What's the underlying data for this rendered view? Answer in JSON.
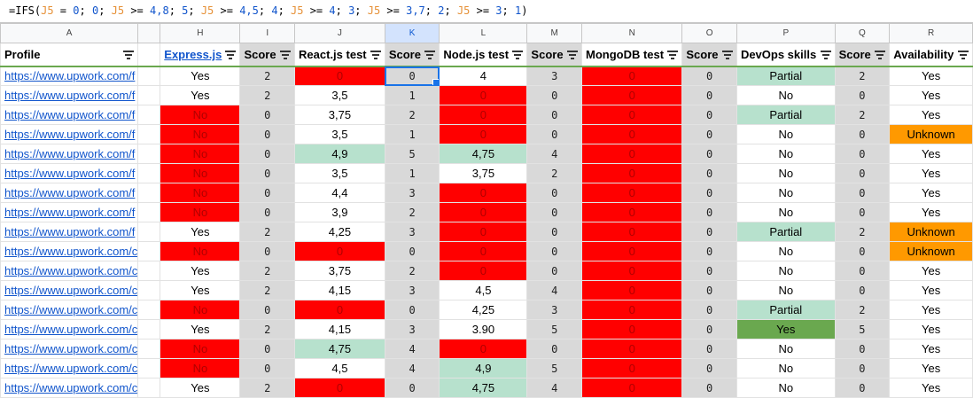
{
  "formula_bar": {
    "tokens": [
      {
        "t": "=IFS(",
        "k": "fn"
      },
      {
        "t": "J5",
        "k": "ref"
      },
      {
        "t": " = ",
        "k": "op"
      },
      {
        "t": "0",
        "k": "num"
      },
      {
        "t": "; ",
        "k": "op"
      },
      {
        "t": "0",
        "k": "num"
      },
      {
        "t": "; ",
        "k": "op"
      },
      {
        "t": "J5",
        "k": "ref"
      },
      {
        "t": " >= ",
        "k": "op"
      },
      {
        "t": "4,8",
        "k": "num"
      },
      {
        "t": "; ",
        "k": "op"
      },
      {
        "t": "5",
        "k": "num"
      },
      {
        "t": "; ",
        "k": "op"
      },
      {
        "t": "J5",
        "k": "ref"
      },
      {
        "t": " >= ",
        "k": "op"
      },
      {
        "t": "4,5",
        "k": "num"
      },
      {
        "t": "; ",
        "k": "op"
      },
      {
        "t": "4",
        "k": "num"
      },
      {
        "t": "; ",
        "k": "op"
      },
      {
        "t": "J5",
        "k": "ref"
      },
      {
        "t": " >= ",
        "k": "op"
      },
      {
        "t": "4",
        "k": "num"
      },
      {
        "t": "; ",
        "k": "op"
      },
      {
        "t": "3",
        "k": "num"
      },
      {
        "t": "; ",
        "k": "op"
      },
      {
        "t": "J5",
        "k": "ref"
      },
      {
        "t": " >= ",
        "k": "op"
      },
      {
        "t": "3,7",
        "k": "num"
      },
      {
        "t": "; ",
        "k": "op"
      },
      {
        "t": "2",
        "k": "num"
      },
      {
        "t": "; ",
        "k": "op"
      },
      {
        "t": "J5",
        "k": "ref"
      },
      {
        "t": " >= ",
        "k": "op"
      },
      {
        "t": "3",
        "k": "num"
      },
      {
        "t": "; ",
        "k": "op"
      },
      {
        "t": "1",
        "k": "num"
      },
      {
        "t": ")",
        "k": "fn"
      }
    ]
  },
  "columns": [
    "A",
    "H",
    "I",
    "J",
    "K",
    "L",
    "M",
    "N",
    "O",
    "P",
    "Q",
    "R"
  ],
  "active_column": "K",
  "headers": [
    "Profile",
    "Express.js",
    "Score",
    "React.js test",
    "Score",
    "Node.js test",
    "Score",
    "MongoDB test",
    "Score",
    "DevOps skills",
    "Score",
    "Availability"
  ],
  "profile_prefix": "https://www.upwork.com/",
  "rows": [
    {
      "profile": "https://www.upwork.com/f",
      "cells": [
        "Yes",
        "2",
        "0",
        "0",
        "4",
        "3",
        "0",
        "0",
        "Partial",
        "2",
        "Yes"
      ],
      "fmt": [
        "",
        "s",
        "r",
        "s",
        "",
        "s",
        "r",
        "s",
        "g",
        "s",
        ""
      ]
    },
    {
      "profile": "https://www.upwork.com/f",
      "cells": [
        "Yes",
        "2",
        "3,5",
        "1",
        "0",
        "0",
        "0",
        "0",
        "No",
        "0",
        "Yes"
      ],
      "fmt": [
        "",
        "s",
        "",
        "s",
        "r",
        "s",
        "r",
        "s",
        "",
        "s",
        ""
      ]
    },
    {
      "profile": "https://www.upwork.com/f",
      "cells": [
        "No",
        "0",
        "3,75",
        "2",
        "0",
        "0",
        "0",
        "0",
        "Partial",
        "2",
        "Yes"
      ],
      "fmt": [
        "r",
        "s",
        "",
        "s",
        "r",
        "s",
        "r",
        "s",
        "g",
        "s",
        ""
      ]
    },
    {
      "profile": "https://www.upwork.com/f",
      "cells": [
        "No",
        "0",
        "3,5",
        "1",
        "0",
        "0",
        "0",
        "0",
        "No",
        "0",
        "Unknown"
      ],
      "fmt": [
        "r",
        "s",
        "",
        "s",
        "r",
        "s",
        "r",
        "s",
        "",
        "s",
        "o"
      ]
    },
    {
      "profile": "https://www.upwork.com/f",
      "cells": [
        "No",
        "0",
        "4,9",
        "5",
        "4,75",
        "4",
        "0",
        "0",
        "No",
        "0",
        "Yes"
      ],
      "fmt": [
        "r",
        "s",
        "g",
        "s",
        "g",
        "s",
        "r",
        "s",
        "",
        "s",
        ""
      ]
    },
    {
      "profile": "https://www.upwork.com/f",
      "cells": [
        "No",
        "0",
        "3,5",
        "1",
        "3,75",
        "2",
        "0",
        "0",
        "No",
        "0",
        "Yes"
      ],
      "fmt": [
        "r",
        "s",
        "",
        "s",
        "",
        "s",
        "r",
        "s",
        "",
        "s",
        ""
      ]
    },
    {
      "profile": "https://www.upwork.com/f",
      "cells": [
        "No",
        "0",
        "4,4",
        "3",
        "0",
        "0",
        "0",
        "0",
        "No",
        "0",
        "Yes"
      ],
      "fmt": [
        "r",
        "s",
        "",
        "s",
        "r",
        "s",
        "r",
        "s",
        "",
        "s",
        ""
      ]
    },
    {
      "profile": "https://www.upwork.com/f",
      "cells": [
        "No",
        "0",
        "3,9",
        "2",
        "0",
        "0",
        "0",
        "0",
        "No",
        "0",
        "Yes"
      ],
      "fmt": [
        "r",
        "s",
        "",
        "s",
        "r",
        "s",
        "r",
        "s",
        "",
        "s",
        ""
      ]
    },
    {
      "profile": "https://www.upwork.com/f",
      "cells": [
        "Yes",
        "2",
        "4,25",
        "3",
        "0",
        "0",
        "0",
        "0",
        "Partial",
        "2",
        "Unknown"
      ],
      "fmt": [
        "",
        "s",
        "",
        "s",
        "r",
        "s",
        "r",
        "s",
        "g",
        "s",
        "o"
      ]
    },
    {
      "profile": "https://www.upwork.com/c",
      "cells": [
        "No",
        "0",
        "0",
        "0",
        "0",
        "0",
        "0",
        "0",
        "No",
        "0",
        "Unknown"
      ],
      "fmt": [
        "r",
        "s",
        "r",
        "s",
        "r",
        "s",
        "r",
        "s",
        "",
        "s",
        "o"
      ]
    },
    {
      "profile": "https://www.upwork.com/c",
      "cells": [
        "Yes",
        "2",
        "3,75",
        "2",
        "0",
        "0",
        "0",
        "0",
        "No",
        "0",
        "Yes"
      ],
      "fmt": [
        "",
        "s",
        "",
        "s",
        "r",
        "s",
        "r",
        "s",
        "",
        "s",
        ""
      ]
    },
    {
      "profile": "https://www.upwork.com/c",
      "cells": [
        "Yes",
        "2",
        "4,15",
        "3",
        "4,5",
        "4",
        "0",
        "0",
        "No",
        "0",
        "Yes"
      ],
      "fmt": [
        "",
        "s",
        "",
        "s",
        "",
        "s",
        "r",
        "s",
        "",
        "s",
        ""
      ]
    },
    {
      "profile": "https://www.upwork.com/c",
      "cells": [
        "No",
        "0",
        "0",
        "0",
        "4,25",
        "3",
        "0",
        "0",
        "Partial",
        "2",
        "Yes"
      ],
      "fmt": [
        "r",
        "s",
        "r",
        "s",
        "",
        "s",
        "r",
        "s",
        "g",
        "s",
        ""
      ]
    },
    {
      "profile": "https://www.upwork.com/c",
      "cells": [
        "Yes",
        "2",
        "4,15",
        "3",
        "3.90",
        "5",
        "0",
        "0",
        "Yes",
        "5",
        "Yes"
      ],
      "fmt": [
        "",
        "s",
        "",
        "s",
        "",
        "s",
        "r",
        "s",
        "d",
        "s",
        ""
      ]
    },
    {
      "profile": "https://www.upwork.com/c",
      "cells": [
        "No",
        "0",
        "4,75",
        "4",
        "0",
        "0",
        "0",
        "0",
        "No",
        "0",
        "Yes"
      ],
      "fmt": [
        "r",
        "s",
        "g",
        "s",
        "r",
        "s",
        "r",
        "s",
        "",
        "s",
        ""
      ]
    },
    {
      "profile": "https://www.upwork.com/c",
      "cells": [
        "No",
        "0",
        "4,5",
        "4",
        "4,9",
        "5",
        "0",
        "0",
        "No",
        "0",
        "Yes"
      ],
      "fmt": [
        "r",
        "s",
        "",
        "s",
        "g",
        "s",
        "r",
        "s",
        "",
        "s",
        ""
      ]
    },
    {
      "profile": "https://www.upwork.com/c",
      "cells": [
        "Yes",
        "2",
        "0",
        "0",
        "4,75",
        "4",
        "0",
        "0",
        "No",
        "0",
        "Yes"
      ],
      "fmt": [
        "",
        "s",
        "r",
        "s",
        "g",
        "s",
        "r",
        "s",
        "",
        "s",
        ""
      ]
    }
  ],
  "colors": {
    "fail_red": "#ff0000",
    "pass_green": "#b7e1cd",
    "strong_green": "#6aa84f",
    "unknown_orange": "#ff9900",
    "score_gray": "#d9d9d9",
    "link_blue": "#1155cc",
    "selection_blue": "#1a73e8"
  }
}
